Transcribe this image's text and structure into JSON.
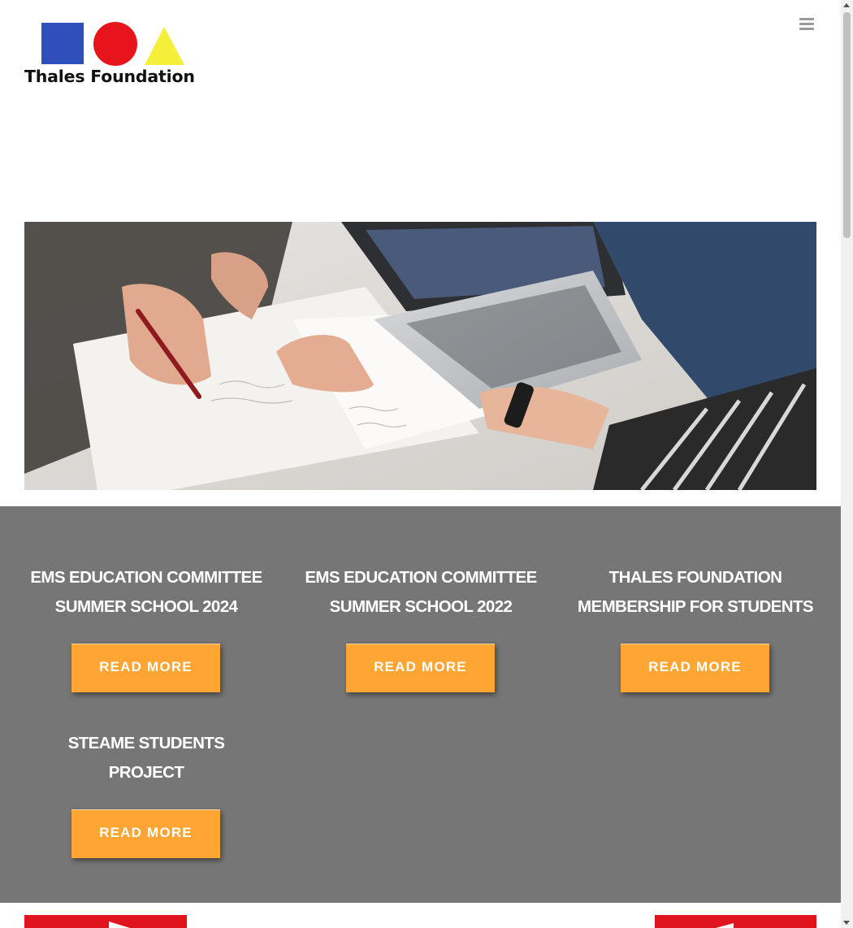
{
  "brand": {
    "name": "Thales Foundation",
    "colors": {
      "square": "#2f4fbb",
      "circle": "#e8141c",
      "triangle": "#f5ef3a"
    }
  },
  "header": {
    "menu_icon": "hamburger-menu-icon"
  },
  "hero": {
    "image": "students-working-with-papers-and-laptop-photo"
  },
  "cards": [
    {
      "title_line1": "EMS EDUCATION COMMITTEE",
      "title_line2": "SUMMER SCHOOL 2024",
      "button": "READ MORE"
    },
    {
      "title_line1": "EMS EDUCATION COMMITTEE",
      "title_line2": "SUMMER SCHOOL 2022",
      "button": "READ MORE"
    },
    {
      "title_line1": "THALES FOUNDATION",
      "title_line2": "MEMBERSHIP FOR STUDENTS",
      "button": "READ MORE"
    },
    {
      "title_line1": "STEAME STUDENTS",
      "title_line2": "PROJECT",
      "button": "READ MORE"
    }
  ],
  "colors": {
    "section_bg": "#767676",
    "button_bg": "#ffa534",
    "accent_red": "#e0141e"
  }
}
